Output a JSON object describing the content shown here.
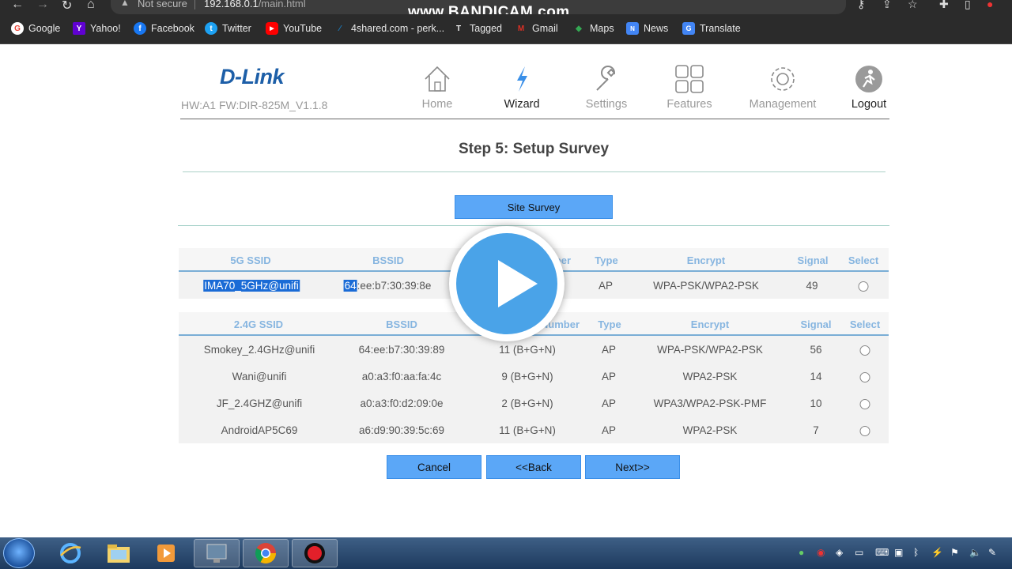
{
  "browser": {
    "not_secure": "Not secure",
    "url_host": "192.168.0.1",
    "url_path": "/main.html",
    "watermark": "www.BANDICAM.com",
    "bookmarks": [
      {
        "label": "Google",
        "icon": "google-icon",
        "color": "#ea4335",
        "glyph": "G"
      },
      {
        "label": "Yahoo!",
        "icon": "yahoo-icon",
        "color": "#6001d2",
        "glyph": "Y"
      },
      {
        "label": "Facebook",
        "icon": "facebook-icon",
        "color": "#1877f2",
        "glyph": "f"
      },
      {
        "label": "Twitter",
        "icon": "twitter-icon",
        "color": "#1da1f2",
        "glyph": "t"
      },
      {
        "label": "YouTube",
        "icon": "youtube-icon",
        "color": "#ff0000",
        "glyph": "▶"
      },
      {
        "label": "4shared.com - perk...",
        "icon": "4shared-icon",
        "color": "#1b7fc2",
        "glyph": "4"
      },
      {
        "label": "Tagged",
        "icon": "tagged-icon",
        "color": "#444444",
        "glyph": "T"
      },
      {
        "label": "Gmail",
        "icon": "gmail-icon",
        "color": "#d93025",
        "glyph": "M"
      },
      {
        "label": "Maps",
        "icon": "maps-icon",
        "color": "#34a853",
        "glyph": "◆"
      },
      {
        "label": "News",
        "icon": "news-icon",
        "color": "#4285f4",
        "glyph": "N"
      },
      {
        "label": "Translate",
        "icon": "translate-icon",
        "color": "#4285f4",
        "glyph": "G"
      }
    ]
  },
  "router": {
    "logo": "D-Link",
    "hw_fw": "HW:A1 FW:DIR-825M_V1.1.8",
    "nav": [
      {
        "label": "Home",
        "icon": "home-icon"
      },
      {
        "label": "Wizard",
        "icon": "wizard-icon"
      },
      {
        "label": "Settings",
        "icon": "wrench-icon"
      },
      {
        "label": "Features",
        "icon": "features-grid-icon"
      },
      {
        "label": "Management",
        "icon": "gear-icon"
      },
      {
        "label": "Logout",
        "icon": "logout-icon"
      }
    ],
    "step_title": "Step 5: Setup Survey",
    "site_survey_label": "Site Survey",
    "table5g": {
      "headers": [
        "5G SSID",
        "BSSID",
        "Channel Number",
        "Type",
        "Encrypt",
        "Signal",
        "Select"
      ],
      "rows": [
        {
          "ssid": "IMA70_5GHz@unifi",
          "bssid_sel": "64",
          "bssid_rest": ":ee:b7:30:39:8e",
          "channel": "",
          "type": "AP",
          "encrypt": "WPA-PSK/WPA2-PSK",
          "signal": "49"
        }
      ]
    },
    "table24g": {
      "headers": [
        "2.4G SSID",
        "BSSID",
        "Channel Number",
        "Type",
        "Encrypt",
        "Signal",
        "Select"
      ],
      "rows": [
        {
          "ssid": "Smokey_2.4GHz@unifi",
          "bssid": "64:ee:b7:30:39:89",
          "channel": "11 (B+G+N)",
          "type": "AP",
          "encrypt": "WPA-PSK/WPA2-PSK",
          "signal": "56"
        },
        {
          "ssid": "Wani@unifi",
          "bssid": "a0:a3:f0:aa:fa:4c",
          "channel": "9 (B+G+N)",
          "type": "AP",
          "encrypt": "WPA2-PSK",
          "signal": "14"
        },
        {
          "ssid": "JF_2.4GHZ@unifi",
          "bssid": "a0:a3:f0:d2:09:0e",
          "channel": "2 (B+G+N)",
          "type": "AP",
          "encrypt": "WPA3/WPA2-PSK-PMF",
          "signal": "10"
        },
        {
          "ssid": "AndroidAP5C69",
          "bssid": "a6:d9:90:39:5c:69",
          "channel": "11 (B+G+N)",
          "type": "AP",
          "encrypt": "WPA2-PSK",
          "signal": "7"
        }
      ]
    },
    "buttons": {
      "cancel": "Cancel",
      "back": "<<Back",
      "next": "Next>>"
    }
  },
  "colors": {
    "accent": "#5ba7f7",
    "header_text": "#86b5e0",
    "logo": "#1d5fa8",
    "play": "#4aa3e8"
  }
}
